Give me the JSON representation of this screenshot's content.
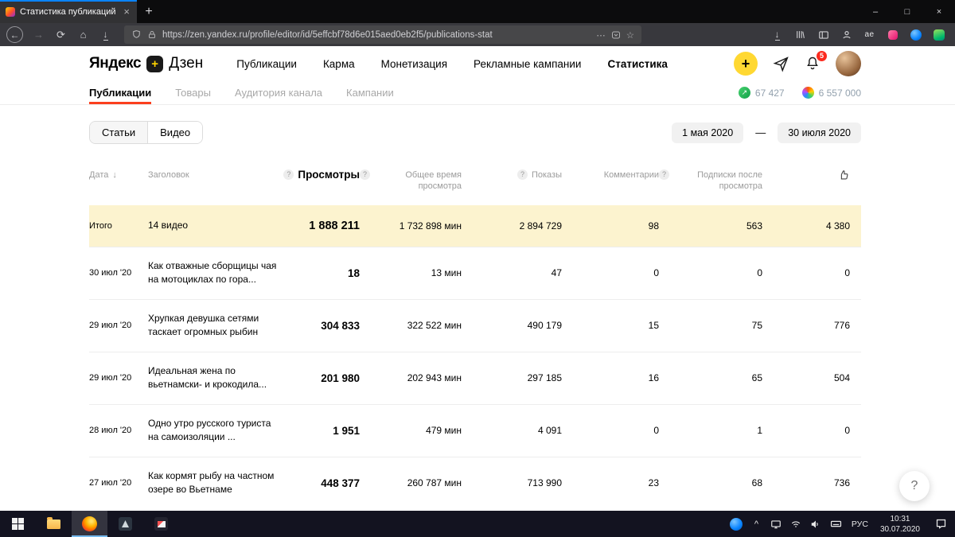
{
  "browser": {
    "tab_title": "Статистика публикаций | Янд",
    "url": "https://zen.yandex.ru/profile/editor/id/5effcbf78d6e015aed0eb2f5/publications-stat"
  },
  "icons": {
    "back": "←",
    "forward": "→",
    "reload": "⟳",
    "home": "⌂",
    "downloads": "↓",
    "more": "⋯",
    "star": "☆",
    "new_tab": "+",
    "close": "×",
    "minimize": "–",
    "maximize": "□",
    "plus": "+",
    "chevron_up": "^",
    "qmark": "?",
    "sort_down": "↓",
    "ext_ae": "ae",
    "green_arrow": "↗"
  },
  "zen": {
    "logo_first": "Яндекс",
    "logo_second": "Дзен",
    "nav": [
      "Публикации",
      "Карма",
      "Монетизация",
      "Рекламные кампании",
      "Статистика"
    ],
    "bell_badge": "5",
    "subnav": [
      "Публикации",
      "Товары",
      "Аудитория канала",
      "Кампании"
    ],
    "stat_left": "67 427",
    "stat_right": "6 557 000",
    "filter_articles": "Статьи",
    "filter_video": "Видео",
    "date_from": "1 мая 2020",
    "date_dash": "—",
    "date_to": "30 июля 2020",
    "help_label": "?"
  },
  "table": {
    "headers": {
      "date": "Дата",
      "title": "Заголовок",
      "views": "Просмотры",
      "time": "Общее время просмотра",
      "shows": "Показы",
      "comments": "Комментарии",
      "subs": "Подписки после просмотра"
    },
    "summary": {
      "date": "Итого",
      "title": "14 видео",
      "views": "1 888 211",
      "time": "1 732 898 мин",
      "shows": "2 894 729",
      "comments": "98",
      "subs": "563",
      "likes": "4 380"
    },
    "rows": [
      {
        "date": "30 июл '20",
        "title": "Как отважные сборщицы чая на мотоциклах по гора...",
        "views": "18",
        "time": "13 мин",
        "shows": "47",
        "comments": "0",
        "subs": "0",
        "likes": "0"
      },
      {
        "date": "29 июл '20",
        "title": "Хрупкая девушка сетями таскает огромных рыбин",
        "views": "304 833",
        "time": "322 522 мин",
        "shows": "490 179",
        "comments": "15",
        "subs": "75",
        "likes": "776"
      },
      {
        "date": "29 июл '20",
        "title": "Идеальная жена по вьетнамски- и крокодила...",
        "views": "201 980",
        "time": "202 943 мин",
        "shows": "297 185",
        "comments": "16",
        "subs": "65",
        "likes": "504"
      },
      {
        "date": "28 июл '20",
        "title": "Одно утро русского туриста на самоизоляции ...",
        "views": "1 951",
        "time": "479 мин",
        "shows": "4 091",
        "comments": "0",
        "subs": "1",
        "likes": "0"
      },
      {
        "date": "27 июл '20",
        "title": "Как кормят рыбу на частном озере во Вьетнаме",
        "views": "448 377",
        "time": "260 787 мин",
        "shows": "713 990",
        "comments": "23",
        "subs": "68",
        "likes": "736"
      }
    ]
  },
  "taskbar": {
    "lang": "РУС",
    "time": "10:31",
    "date": "30.07.2020"
  }
}
